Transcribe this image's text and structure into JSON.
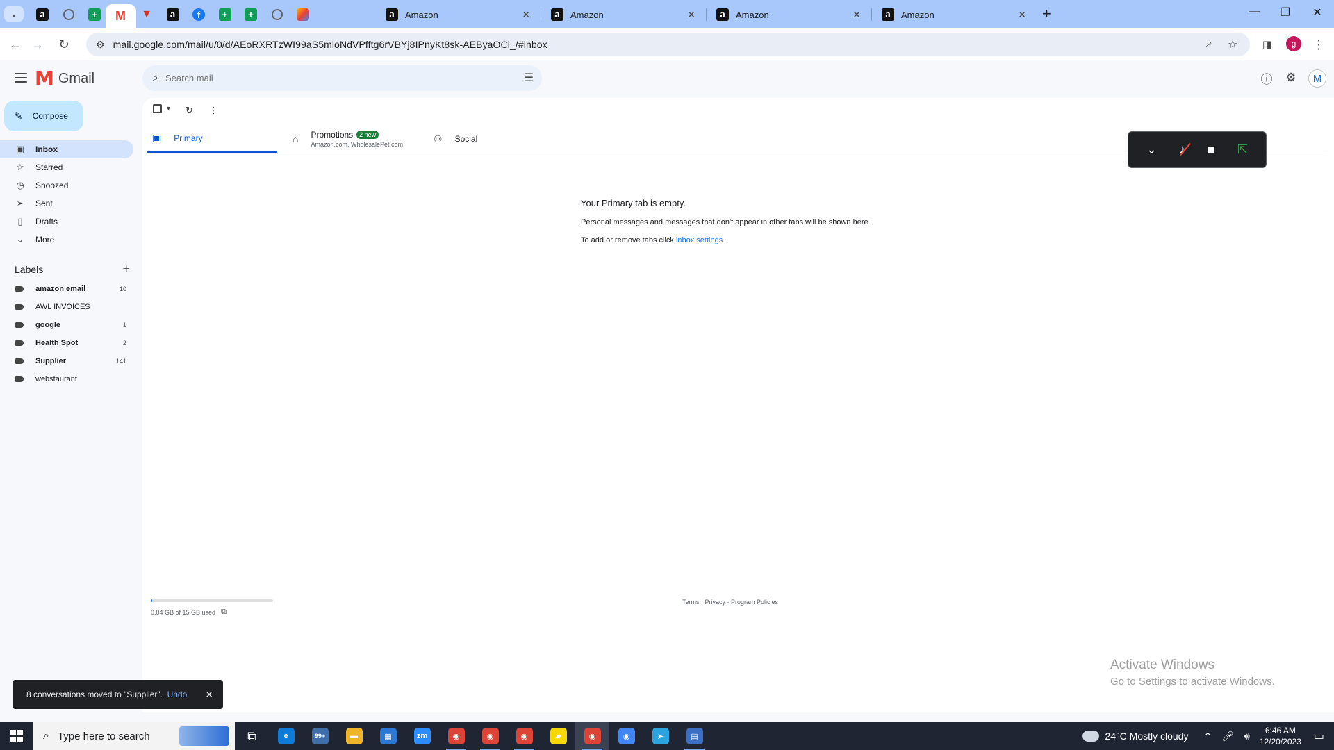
{
  "browser": {
    "pinned_tabs": [
      {
        "icon": "amazon-icon",
        "glyph": "a"
      },
      {
        "icon": "globe-icon",
        "glyph": ""
      },
      {
        "icon": "sheets-icon",
        "glyph": "+"
      },
      {
        "icon": "gmail-icon",
        "glyph": "M"
      },
      {
        "icon": "red-logo-icon",
        "glyph": "▼"
      },
      {
        "icon": "amazon-icon",
        "glyph": "a"
      },
      {
        "icon": "facebook-icon",
        "glyph": "f"
      },
      {
        "icon": "sheets-icon",
        "glyph": "+"
      },
      {
        "icon": "sheets-icon",
        "glyph": "+"
      },
      {
        "icon": "globe-icon",
        "glyph": ""
      },
      {
        "icon": "multicolor-app-icon",
        "glyph": ""
      }
    ],
    "tabs": [
      {
        "title": "Amazon",
        "icon": "amazon-icon"
      },
      {
        "title": "Amazon",
        "icon": "amazon-icon"
      },
      {
        "title": "Amazon",
        "icon": "amazon-icon"
      },
      {
        "title": "Amazon",
        "icon": "amazon-icon"
      }
    ],
    "url": "mail.google.com/mail/u/0/d/AEoRXRTzWI99aS5mloNdVPfftg6rVBYj8IPnyKt8sk-AEByaOCi_/#inbox",
    "profile_initial": "g"
  },
  "gmail": {
    "logo_text": "Gmail",
    "search_placeholder": "Search mail",
    "account_initial": "M",
    "compose_label": "Compose",
    "nav": [
      {
        "label": "Inbox",
        "icon": "inbox-icon",
        "glyph": "▣",
        "active": true
      },
      {
        "label": "Starred",
        "icon": "star-icon",
        "glyph": "☆",
        "active": false
      },
      {
        "label": "Snoozed",
        "icon": "clock-icon",
        "glyph": "◷",
        "active": false
      },
      {
        "label": "Sent",
        "icon": "send-icon",
        "glyph": "➢",
        "active": false
      },
      {
        "label": "Drafts",
        "icon": "draft-icon",
        "glyph": "▯",
        "active": false
      },
      {
        "label": "More",
        "icon": "chevron-down-icon",
        "glyph": "⌄",
        "active": false
      }
    ],
    "labels_title": "Labels",
    "labels": [
      {
        "name": "amazon email",
        "count": "10",
        "bold": true
      },
      {
        "name": "AWL INVOICES",
        "count": "",
        "bold": false
      },
      {
        "name": "google",
        "count": "1",
        "bold": true
      },
      {
        "name": "Health Spot",
        "count": "2",
        "bold": true
      },
      {
        "name": "Supplier",
        "count": "141",
        "bold": true
      },
      {
        "name": "webstaurant",
        "count": "",
        "bold": false
      }
    ],
    "tabs": {
      "primary": "Primary",
      "promotions": "Promotions",
      "promotions_badge": "2 new",
      "promotions_senders": "Amazon.com, WholesalePet.com",
      "social": "Social"
    },
    "empty": {
      "heading": "Your Primary tab is empty.",
      "line1": "Personal messages and messages that don't appear in other tabs will be shown here.",
      "line2_prefix": "To add or remove tabs click ",
      "line2_link": "inbox settings",
      "line2_suffix": "."
    },
    "storage": {
      "text": "0.04 GB of 15 GB used",
      "used_fraction": 0.003
    },
    "footer": "Terms · Privacy · Program Policies",
    "snackbar": {
      "message": "8 conversations moved to \"Supplier\".",
      "action": "Undo"
    }
  },
  "watermark": {
    "line1": "Activate Windows",
    "line2": "Go to Settings to activate Windows."
  },
  "taskbar": {
    "search_placeholder": "Type here to search",
    "apps": [
      {
        "name": "task-view",
        "glyph": "⧉",
        "bg": "transparent",
        "open": false
      },
      {
        "name": "edge",
        "glyph": "e",
        "bg": "#0f7bd8",
        "open": false
      },
      {
        "name": "mail-badge-99",
        "glyph": "99+",
        "bg": "#3f6ea8",
        "open": false
      },
      {
        "name": "file-explorer",
        "glyph": "▬",
        "bg": "#f0b429",
        "open": false
      },
      {
        "name": "store",
        "glyph": "▦",
        "bg": "#2b78d4",
        "open": false
      },
      {
        "name": "zoom",
        "glyph": "zm",
        "bg": "#2d8cff",
        "open": false
      },
      {
        "name": "chrome-1",
        "glyph": "◉",
        "bg": "#db4437",
        "open": true
      },
      {
        "name": "chrome-2",
        "glyph": "◉",
        "bg": "#db4437",
        "open": true
      },
      {
        "name": "chrome-3",
        "glyph": "◉",
        "bg": "#db4437",
        "open": true
      },
      {
        "name": "sticky-notes",
        "glyph": "▰",
        "bg": "#f7d700",
        "open": false
      },
      {
        "name": "chrome-4",
        "glyph": "◉",
        "bg": "#db4437",
        "open": true
      },
      {
        "name": "chrome-5",
        "glyph": "◉",
        "bg": "#4285f4",
        "open": false
      },
      {
        "name": "telegram",
        "glyph": "➤",
        "bg": "#2aa3df",
        "open": false
      },
      {
        "name": "calculator",
        "glyph": "▤",
        "bg": "#3b6fc4",
        "open": true
      }
    ],
    "weather": "24°C  Mostly cloudy",
    "time": "6:46 AM",
    "date": "12/20/2023"
  }
}
